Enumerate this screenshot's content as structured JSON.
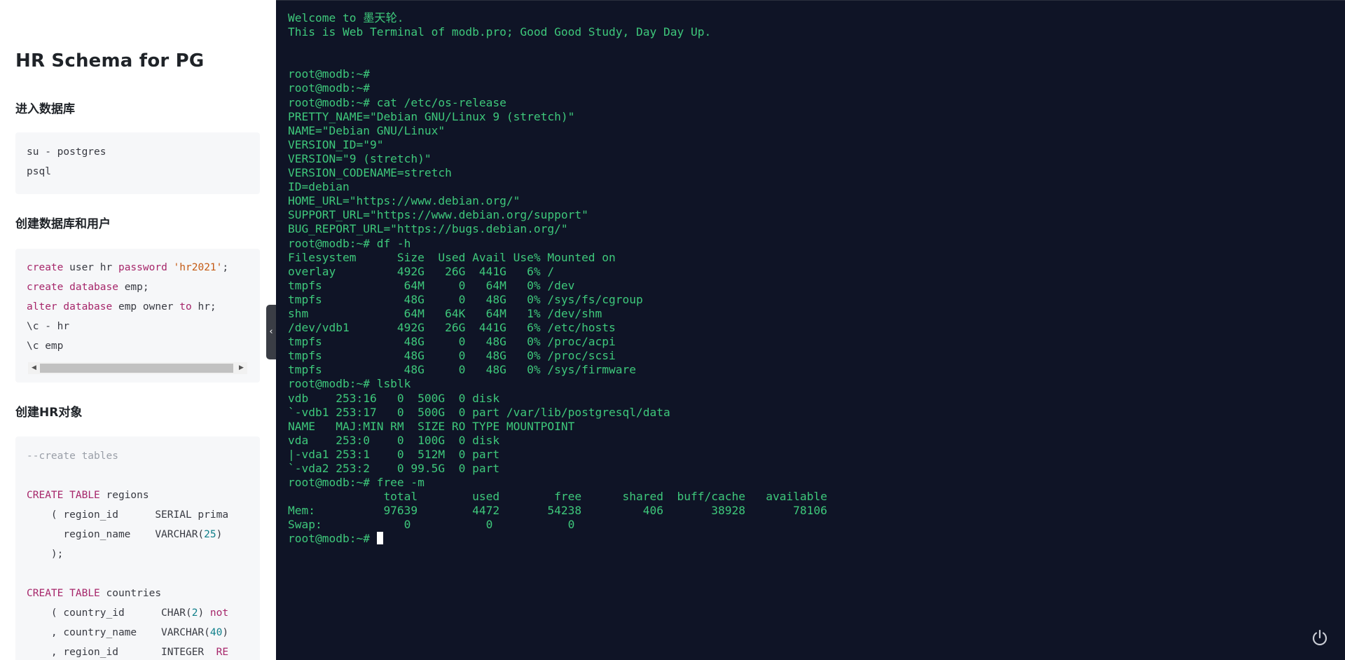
{
  "doc": {
    "title": "HR Schema for PG",
    "sections": [
      {
        "heading": "进入数据库",
        "lines": [
          [
            {
              "t": "su - postgres",
              "c": ""
            }
          ],
          [
            {
              "t": "psql",
              "c": ""
            }
          ]
        ]
      },
      {
        "heading": "创建数据库和用户",
        "lines": [
          [
            {
              "t": "create",
              "c": "kw"
            },
            {
              "t": " user hr ",
              "c": ""
            },
            {
              "t": "password",
              "c": "kw"
            },
            {
              "t": " ",
              "c": ""
            },
            {
              "t": "'hr2021'",
              "c": "str"
            },
            {
              "t": ";",
              "c": ""
            }
          ],
          [
            {
              "t": "create",
              "c": "kw"
            },
            {
              "t": " ",
              "c": ""
            },
            {
              "t": "database",
              "c": "kw"
            },
            {
              "t": " emp;",
              "c": ""
            }
          ],
          [
            {
              "t": "alter",
              "c": "kw"
            },
            {
              "t": " ",
              "c": ""
            },
            {
              "t": "database",
              "c": "kw"
            },
            {
              "t": " emp owner ",
              "c": ""
            },
            {
              "t": "to",
              "c": "kw"
            },
            {
              "t": " hr;",
              "c": ""
            }
          ],
          [
            {
              "t": "\\c - hr",
              "c": ""
            }
          ],
          [
            {
              "t": "\\c emp",
              "c": ""
            }
          ]
        ]
      },
      {
        "heading": "创建HR对象",
        "lines": [
          [
            {
              "t": "--create tables",
              "c": "cmt"
            }
          ],
          [
            {
              "t": "",
              "c": ""
            }
          ],
          [
            {
              "t": "CREATE",
              "c": "kw"
            },
            {
              "t": " ",
              "c": ""
            },
            {
              "t": "TABLE",
              "c": "kw"
            },
            {
              "t": " regions",
              "c": ""
            }
          ],
          [
            {
              "t": "    ( region_id      SERIAL prima",
              "c": ""
            }
          ],
          [
            {
              "t": "      region_name    VARCHAR(",
              "c": ""
            },
            {
              "t": "25",
              "c": "num"
            },
            {
              "t": ")",
              "c": ""
            }
          ],
          [
            {
              "t": "    );",
              "c": ""
            }
          ],
          [
            {
              "t": "",
              "c": ""
            }
          ],
          [
            {
              "t": "CREATE",
              "c": "kw"
            },
            {
              "t": " ",
              "c": ""
            },
            {
              "t": "TABLE",
              "c": "kw"
            },
            {
              "t": " countries",
              "c": ""
            }
          ],
          [
            {
              "t": "    ( country_id      CHAR(",
              "c": ""
            },
            {
              "t": "2",
              "c": "num"
            },
            {
              "t": ") ",
              "c": ""
            },
            {
              "t": "not",
              "c": "kw"
            }
          ],
          [
            {
              "t": "    , country_name    VARCHAR(",
              "c": ""
            },
            {
              "t": "40",
              "c": "num"
            },
            {
              "t": ")",
              "c": ""
            }
          ],
          [
            {
              "t": "    , region_id       INTEGER  ",
              "c": ""
            },
            {
              "t": "RE",
              "c": "kw"
            }
          ]
        ]
      }
    ]
  },
  "terminal": {
    "banner": [
      "Welcome to 墨天轮.",
      "This is Web Terminal of modb.pro; Good Good Study, Day Day Up."
    ],
    "lines": [
      "",
      "",
      "root@modb:~#",
      "root@modb:~#",
      "root@modb:~# cat /etc/os-release",
      "PRETTY_NAME=\"Debian GNU/Linux 9 (stretch)\"",
      "NAME=\"Debian GNU/Linux\"",
      "VERSION_ID=\"9\"",
      "VERSION=\"9 (stretch)\"",
      "VERSION_CODENAME=stretch",
      "ID=debian",
      "HOME_URL=\"https://www.debian.org/\"",
      "SUPPORT_URL=\"https://www.debian.org/support\"",
      "BUG_REPORT_URL=\"https://bugs.debian.org/\"",
      "root@modb:~# df -h",
      "Filesystem      Size  Used Avail Use% Mounted on",
      "overlay         492G   26G  441G   6% /",
      "tmpfs            64M     0   64M   0% /dev",
      "tmpfs            48G     0   48G   0% /sys/fs/cgroup",
      "shm              64M   64K   64M   1% /dev/shm",
      "/dev/vdb1       492G   26G  441G   6% /etc/hosts",
      "tmpfs            48G     0   48G   0% /proc/acpi",
      "tmpfs            48G     0   48G   0% /proc/scsi",
      "tmpfs            48G     0   48G   0% /sys/firmware",
      "root@modb:~# lsblk",
      "vdb    253:16   0  500G  0 disk",
      "`-vdb1 253:17   0  500G  0 part /var/lib/postgresql/data",
      "NAME   MAJ:MIN RM  SIZE RO TYPE MOUNTPOINT",
      "vda    253:0    0  100G  0 disk",
      "|-vda1 253:1    0  512M  0 part",
      "`-vda2 253:2    0 99.5G  0 part",
      "root@modb:~# free -m",
      "              total        used        free      shared  buff/cache   available",
      "Mem:          97639        4472       54238         406       38928       78106",
      "Swap:            0           0           0"
    ],
    "prompt": "root@modb:~# "
  },
  "icons": {
    "collapse": "chevron-left-icon",
    "power": "power-icon",
    "scroll_left": "triangle-left-icon",
    "scroll_right": "triangle-right-icon"
  },
  "colors": {
    "terminal_bg": "#0f1426",
    "terminal_text": "#3ec87b",
    "keyword": "#a6266a",
    "string": "#c45a14",
    "number": "#0f7f8a"
  }
}
